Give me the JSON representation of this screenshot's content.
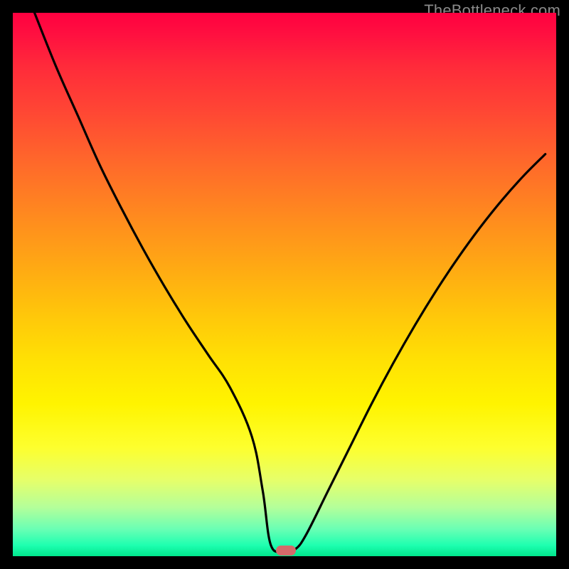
{
  "watermark": "TheBottleneck.com",
  "colors": {
    "gradient_top": "#ff0040",
    "gradient_mid": "#ffd500",
    "gradient_bottom": "#00e68c",
    "curve": "#000000",
    "frame": "#000000",
    "marker": "#d46a6a"
  },
  "chart_data": {
    "type": "line",
    "title": "",
    "xlabel": "",
    "ylabel": "",
    "xlim": [
      0,
      100
    ],
    "ylim": [
      0,
      100
    ],
    "grid": false,
    "legend": false,
    "annotations": [],
    "x": [
      4,
      8,
      12,
      16,
      20,
      24,
      28,
      32,
      36,
      40,
      44,
      46,
      47.5,
      50,
      52,
      54,
      58,
      62,
      66,
      70,
      74,
      78,
      82,
      86,
      90,
      94,
      98
    ],
    "values": [
      100,
      90,
      81,
      72,
      64,
      56.5,
      49.5,
      43,
      37,
      31,
      22,
      12,
      2,
      1,
      1.3,
      4,
      12,
      20,
      28,
      35.5,
      42.5,
      49,
      55,
      60.5,
      65.5,
      70,
      74
    ],
    "flat_segment": {
      "x0": 47.7,
      "x1": 52.2,
      "y": 1.1
    },
    "marker": {
      "x": 50.3,
      "y": 1.1
    }
  }
}
